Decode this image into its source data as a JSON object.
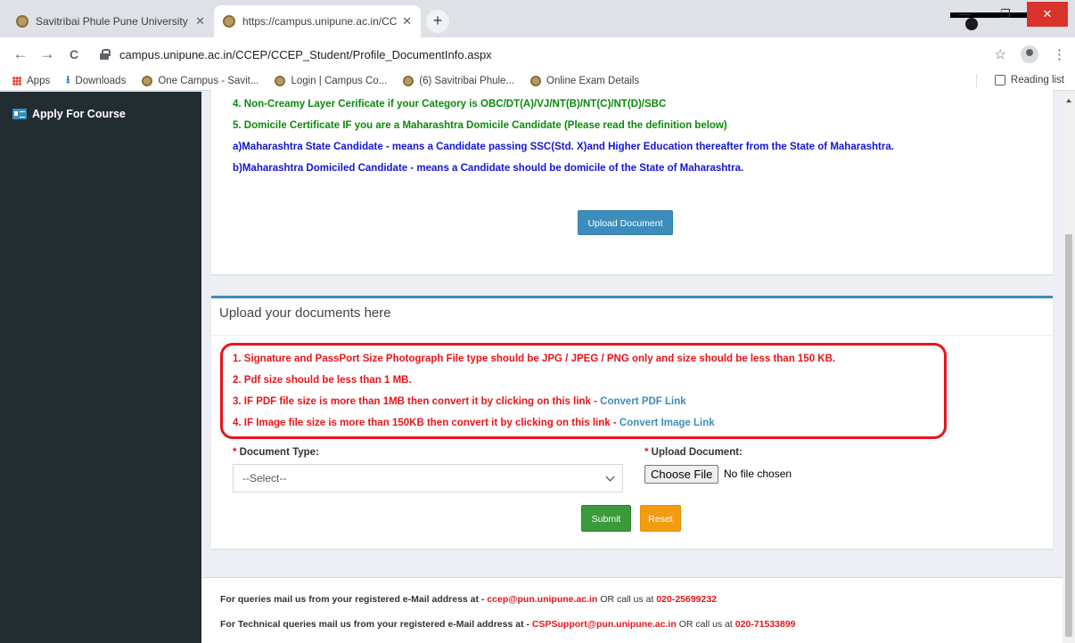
{
  "browser": {
    "tabs": [
      {
        "title": "Savitribai Phule Pune University \\",
        "close": "✕"
      },
      {
        "title": "https://campus.unipune.ac.in/CC",
        "close": "✕"
      }
    ],
    "new_tab": "+",
    "nav": {
      "back": "←",
      "forward": "→",
      "reload": "C"
    },
    "url": "campus.unipune.ac.in/CCEP/CCEP_Student/Profile_DocumentInfo.aspx",
    "star": "☆",
    "menu": "⋮",
    "window": {
      "minimize": "—",
      "restore": "❐",
      "close": "✕"
    },
    "bookmarks": [
      "Apps",
      "Downloads",
      "One Campus - Savit...",
      "Login | Campus Co...",
      "(6) Savitribai Phule...",
      "Online Exam Details"
    ],
    "reading_list": "Reading list"
  },
  "sidebar": {
    "apply_for_course": "Apply For Course"
  },
  "instructions": {
    "line4": "4. Non-Creamy Layer Cerificate if your Category is OBC/DT(A)/VJ/NT(B)/NT(C)/NT(D)/SBC",
    "line5": "5. Domicile Certificate IF you are a Maharashtra Domicile Candidate (Please read the definition below)",
    "def_a": "a)Maharashtra State Candidate - means a Candidate passing SSC(Std. X)and Higher Education thereafter from the State of Maharashtra.",
    "def_b": "b)Maharashtra Domiciled Candidate - means a Candidate should be domicile of the State of Maharashtra.",
    "upload_button": "Upload Document"
  },
  "upload_box": {
    "title": "Upload your documents here",
    "rule1": "1. Signature and PassPort Size Photograph File type should be JPG / JPEG / PNG only and size should be less than 150 KB.",
    "rule2": "2. Pdf size should be less than 1 MB.",
    "rule3": "3. IF PDF file size is more than 1MB then convert it by clicking on this link - ",
    "rule3_link": "Convert PDF Link",
    "rule4": "4. IF Image file size is more than 150KB then convert it by clicking on this link - ",
    "rule4_link": "Convert Image Link",
    "doc_type_label": "Document Type:",
    "upload_label": "Upload Document:",
    "required_mark": "* ",
    "select_value": "--Select--",
    "choose_file": "Choose File",
    "no_file": "No file chosen",
    "submit": "Submit",
    "reset": "Reset"
  },
  "footer": {
    "q1_prefix": "For queries mail us from your registered e-Mail address at - ",
    "q1_email": "ccep@pun.unipune.ac.in",
    "q1_mid": " OR call us at ",
    "q1_phone": "020-25699232",
    "q2_prefix": "For Technical queries mail us from your registered e-Mail address at - ",
    "q2_email": "CSPSupport@pun.unipune.ac.in",
    "q2_mid": " OR call us at ",
    "q2_phone": "020-71533899"
  }
}
